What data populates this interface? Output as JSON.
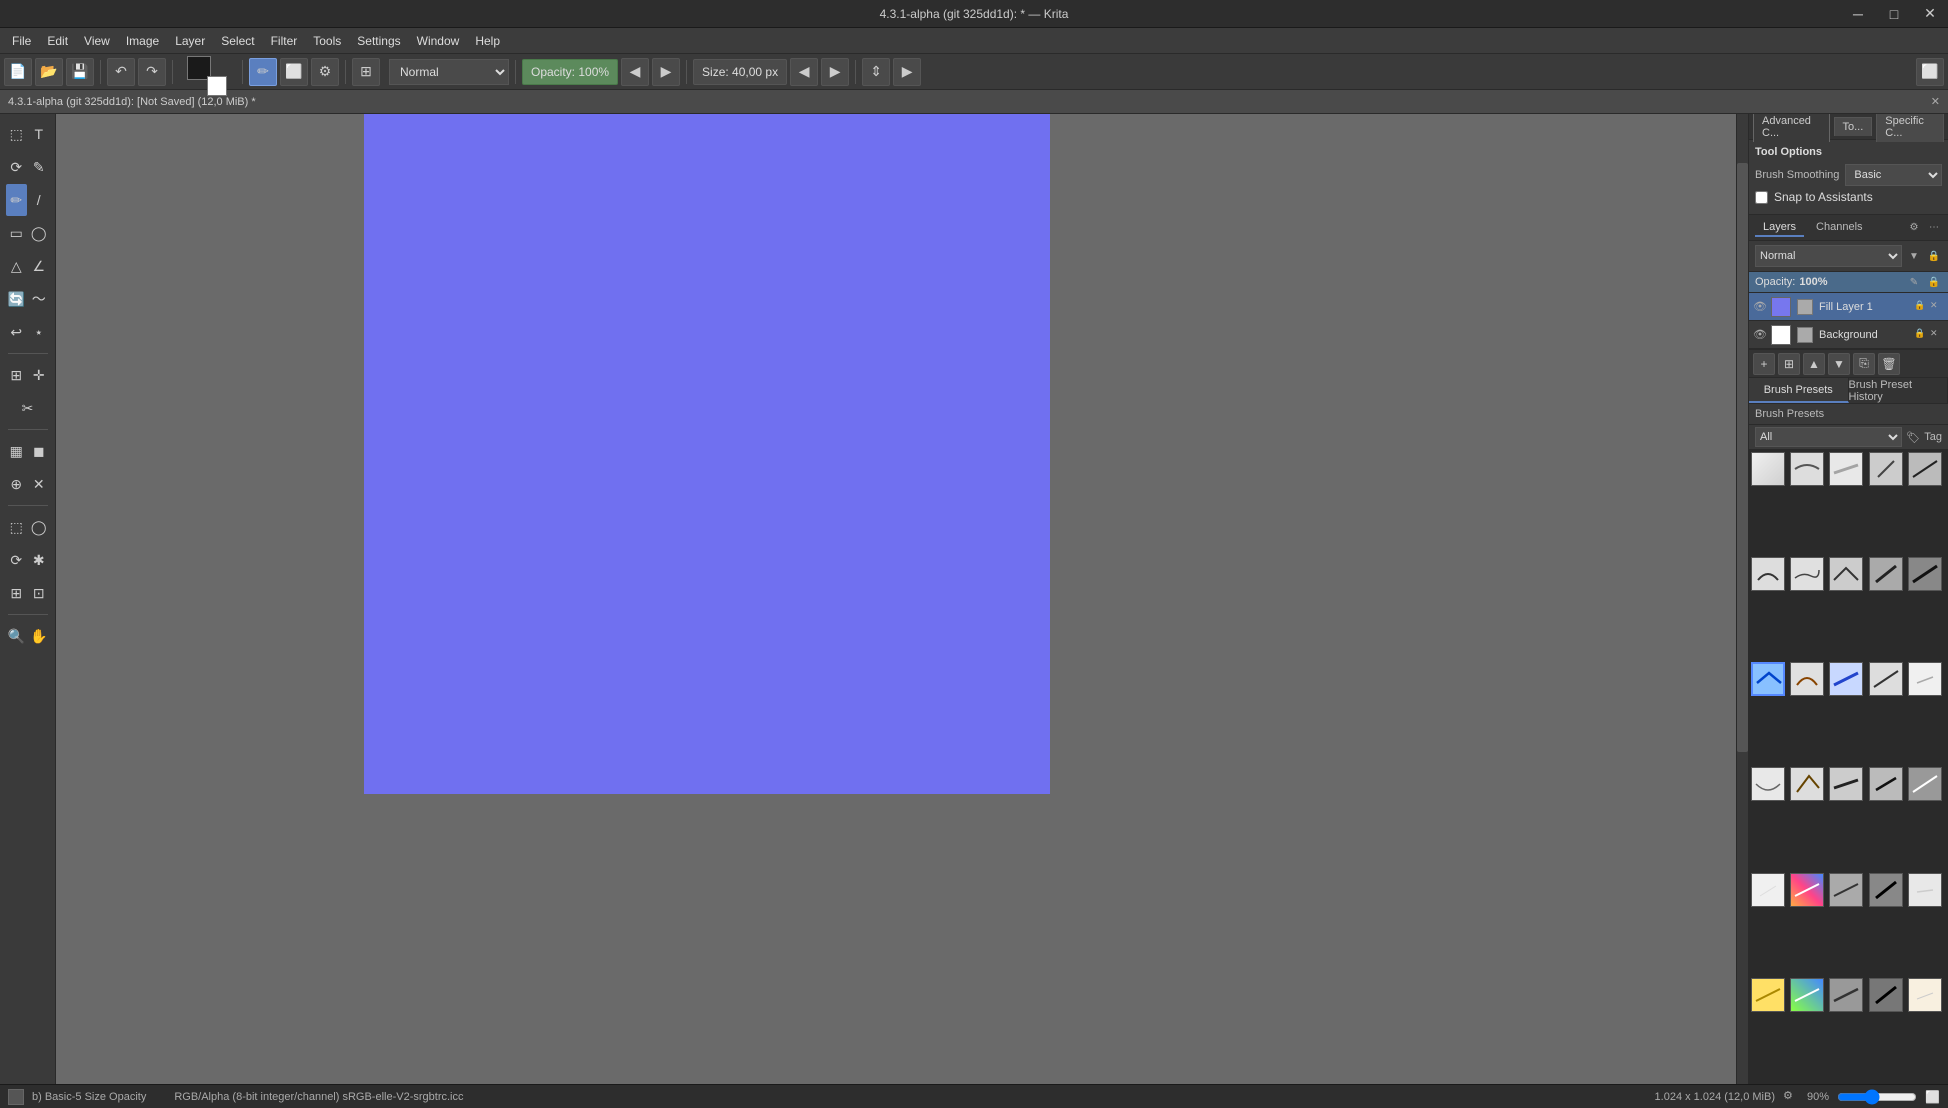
{
  "window": {
    "title": "4.3.1-alpha (git 325dd1d): * — Krita",
    "min_btn": "─",
    "max_btn": "□",
    "close_btn": "✕"
  },
  "menu": {
    "items": [
      "File",
      "Edit",
      "View",
      "Image",
      "Layer",
      "Select",
      "Filter",
      "Tools",
      "Settings",
      "Window",
      "Help"
    ]
  },
  "toolbar": {
    "blend_mode": "Normal",
    "opacity_label": "Opacity: 100%",
    "size_label": "Size: 40,00 px",
    "new_icon": "📄",
    "open_icon": "📂",
    "save_icon": "💾"
  },
  "doc_tab": {
    "label": "4.3.1-alpha (git 325dd1d):  [Not Saved]  (12,0 MiB) *"
  },
  "canvas": {
    "bg_color": "#7070f0",
    "scroll_h": 0,
    "scroll_v": 0
  },
  "right_panel": {
    "tabs": [
      "Advanced C...",
      "To...",
      "Specific C..."
    ],
    "tool_options": {
      "title": "Tool Options",
      "brush_smoothing_label": "Brush Smoothing",
      "brush_smoothing_value": "Basic",
      "snap_to_assistants": "Snap to Assistants"
    }
  },
  "layers_panel": {
    "title": "Layers",
    "tabs": [
      "Layers",
      "Channels"
    ],
    "blend_mode": "Normal",
    "opacity_label": "Opacity:",
    "opacity_value": "100%",
    "layers": [
      {
        "name": "Fill Layer 1",
        "type": "fill",
        "visible": true,
        "active": true
      },
      {
        "name": "Background",
        "type": "paint",
        "visible": true,
        "active": false
      }
    ]
  },
  "brush_presets": {
    "tab_presets": "Brush Presets",
    "tab_history": "Brush Preset History",
    "filter_label": "All",
    "tag_label": "Tag",
    "presets": [
      {
        "id": 1,
        "style": "light"
      },
      {
        "id": 2,
        "style": "medium"
      },
      {
        "id": 3,
        "style": "dark"
      },
      {
        "id": 4,
        "style": "gray"
      },
      {
        "id": 5,
        "style": "dark2"
      },
      {
        "id": 6,
        "style": "dark3"
      },
      {
        "id": 7,
        "style": "medium2"
      },
      {
        "id": 8,
        "style": "dark4"
      },
      {
        "id": 9,
        "style": "dark5"
      },
      {
        "id": 10,
        "style": "dark6"
      },
      {
        "id": 11,
        "style": "blue-selected"
      },
      {
        "id": 12,
        "style": "medium3"
      },
      {
        "id": 13,
        "style": "blue2"
      },
      {
        "id": 14,
        "style": "dark7"
      },
      {
        "id": 15,
        "style": "light2"
      },
      {
        "id": 16,
        "style": "light3"
      },
      {
        "id": 17,
        "style": "medium4"
      },
      {
        "id": 18,
        "style": "dark8"
      },
      {
        "id": 19,
        "style": "dark9"
      },
      {
        "id": 20,
        "style": "dark10"
      },
      {
        "id": 21,
        "style": "light4"
      },
      {
        "id": 22,
        "style": "colored"
      },
      {
        "id": 23,
        "style": "dark11"
      },
      {
        "id": 24,
        "style": "dark12"
      },
      {
        "id": 25,
        "style": "light5"
      },
      {
        "id": 26,
        "style": "yellow"
      },
      {
        "id": 27,
        "style": "colored2"
      },
      {
        "id": 28,
        "style": "dark13"
      },
      {
        "id": 29,
        "style": "dark14"
      },
      {
        "id": 30,
        "style": "light6"
      }
    ]
  },
  "status_bar": {
    "tool_label": "b) Basic-5 Size Opacity",
    "color_mode": "RGB/Alpha (8-bit integer/channel)  sRGB-elle-V2-srgbtrc.icc",
    "dimensions": "1.024 x 1.024 (12,0 MiB)",
    "zoom": "90%"
  }
}
